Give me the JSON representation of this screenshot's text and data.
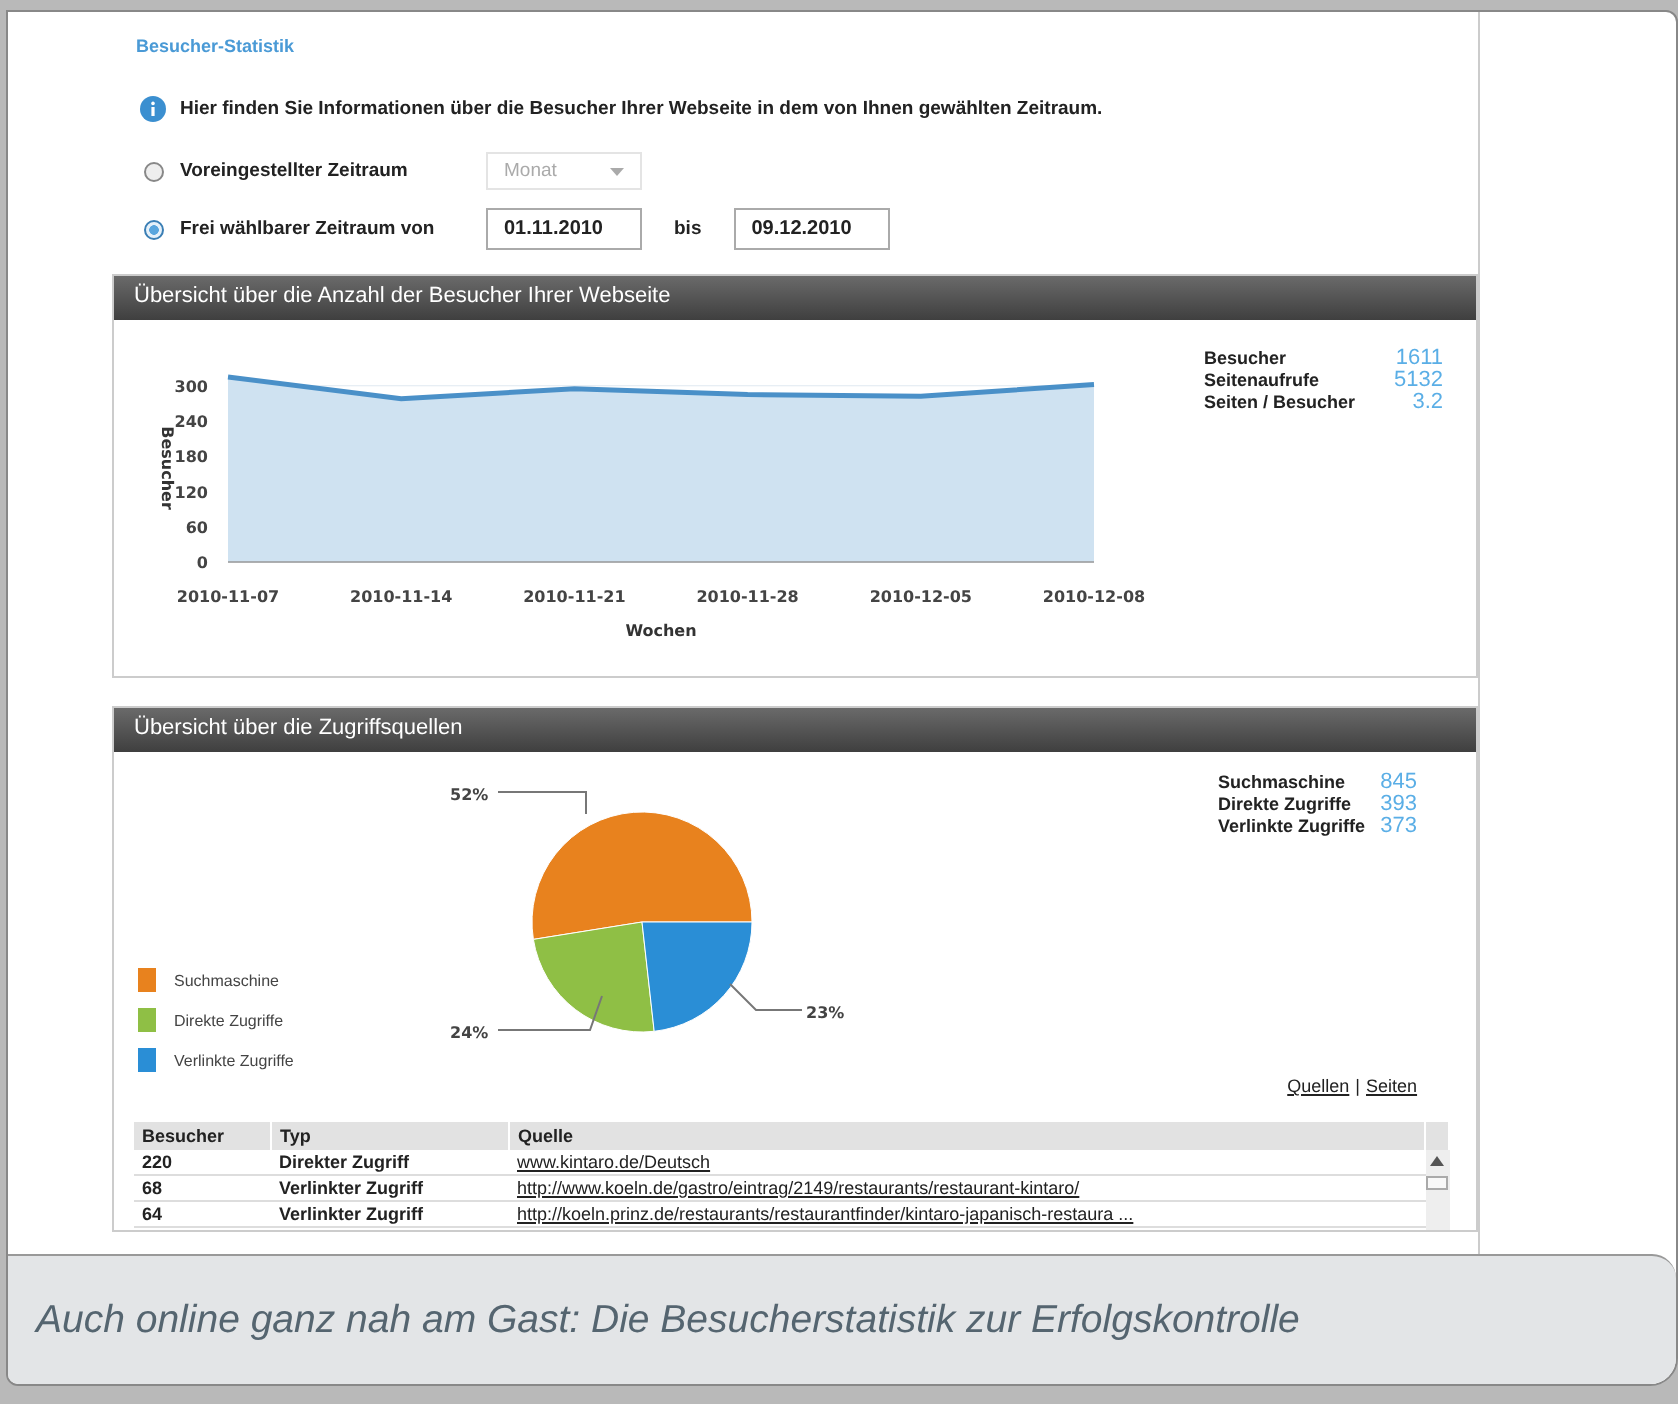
{
  "page_title": "Besucher-Statistik",
  "info": "Hier finden Sie Informationen über die Besucher Ihrer Webseite in dem von Ihnen gewählten Zeitraum.",
  "period_options": [
    {
      "kind": "select",
      "label": "Voreingestellter Zeitraum",
      "selected": false,
      "value": "Monat",
      "disabled": true
    },
    {
      "kind": "range",
      "label": "Frei wählbarer Zeitraum von",
      "selected": true,
      "from": "01.11.2010",
      "separator": "bis",
      "to": "09.12.2010"
    }
  ],
  "visitors_section": {
    "title": "Übersicht über die Anzahl der Besucher Ihrer Webseite",
    "chart_data": {
      "type": "line",
      "xlabel": "Wochen",
      "ylabel": "Besucher",
      "categories": [
        "2010-11-07",
        "2010-11-14",
        "2010-11-21",
        "2010-11-28",
        "2010-12-05",
        "2010-12-08"
      ],
      "values": [
        315,
        278,
        295,
        285,
        282,
        302
      ],
      "ylim": [
        0,
        320
      ],
      "yticks": [
        0,
        60,
        120,
        180,
        240,
        300
      ]
    },
    "stats": [
      {
        "label": "Besucher",
        "value": "1611"
      },
      {
        "label": "Seitenaufrufe",
        "value": "5132"
      },
      {
        "label": "Seiten / Besucher",
        "value": "3.2"
      }
    ]
  },
  "sources_section": {
    "title": "Übersicht über die Zugriffsquellen",
    "chart_data": {
      "type": "pie",
      "categories": [
        "Suchmaschine",
        "Direkte Zugriffe",
        "Verlinkte Zugriffe"
      ],
      "values": [
        52,
        24,
        23
      ],
      "colors": [
        "#e8821e",
        "#8fbf45",
        "#2a8ed6"
      ],
      "value_labels": [
        "52%",
        "24%",
        "23%"
      ]
    },
    "stats": [
      {
        "label": "Suchmaschine",
        "value": "845"
      },
      {
        "label": "Direkte Zugriffe",
        "value": "393"
      },
      {
        "label": "Verlinkte Zugriffe",
        "value": "373"
      }
    ],
    "links": [
      {
        "label": "Quellen"
      },
      {
        "label": "Seiten"
      }
    ],
    "link_separator": "|",
    "table": {
      "columns": [
        "Besucher",
        "Typ",
        "Quelle"
      ],
      "rows": [
        {
          "visitors": "220",
          "type": "Direkter Zugriff",
          "source": "www.kintaro.de/Deutsch"
        },
        {
          "visitors": "68",
          "type": "Verlinkter Zugriff",
          "source": "http://www.koeln.de/gastro/eintrag/2149/restaurants/restaurant-kintaro/"
        },
        {
          "visitors": "64",
          "type": "Verlinkter Zugriff",
          "source": "http://koeln.prinz.de/restaurants/restaurantfinder/kintaro-japanisch-restaura ..."
        }
      ]
    }
  },
  "caption": "Auch online ganz nah am Gast: Die Besucherstatistik zur Erfolgskontrolle"
}
